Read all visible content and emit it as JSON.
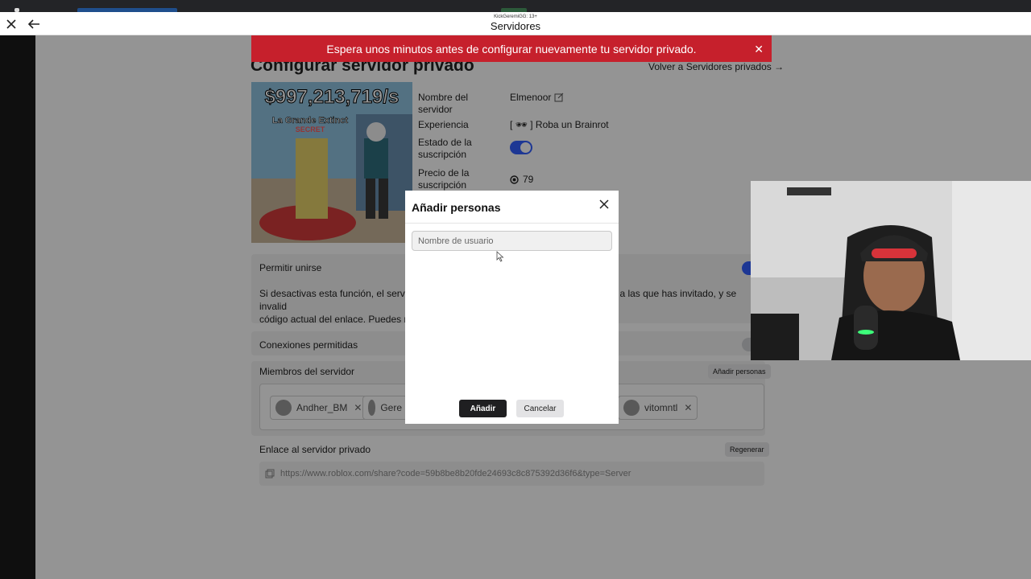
{
  "window": {
    "small_title": "KickGeremiGG: 13+",
    "title": "Servidores"
  },
  "page": {
    "heading": "Configurar servidor privado",
    "back_link": "Volver a Servidores privados →",
    "thumbnail": {
      "price_text": "$997,213,719/s",
      "subtitle": "La Grande Extinct",
      "tag": "SECRET"
    },
    "fields": {
      "server_name_label": "Nombre del servidor",
      "server_name_value": "Elmenoor",
      "experience_label": "Experiencia",
      "experience_value": "[ 🕶 ] Roba un Brainrot",
      "subscription_state_label": "Estado de la suscripción",
      "subscription_price_label": "Precio de la suscripción",
      "subscription_price_value": "79"
    },
    "allow_join_label": "Permitir unirse",
    "allow_join_desc_left": "Si desactivas esta función, el servidor",
    "allow_join_desc_right": "a las que has invitado, y se invalid",
    "allow_join_desc_line2": "código actual del enlace. Puedes reac",
    "connections_label": "Conexiones permitidas",
    "members_label": "Miembros del servidor",
    "add_people_button": "Añadir personas",
    "members": [
      "Andher_BM",
      "Gere",
      "vitomntl"
    ],
    "link_label": "Enlace al servidor privado",
    "regenerate_button": "Regenerar",
    "link_value": "https://www.roblox.com/share?code=59b8be8b20fde24693c8c875392d36f6&type=Server"
  },
  "banner": {
    "message": "Espera unos minutos antes de configurar nuevamente tu servidor privado."
  },
  "dialog": {
    "title": "Añadir personas",
    "input_placeholder": "Nombre de usuario",
    "add_button": "Añadir",
    "cancel_button": "Cancelar"
  },
  "colors": {
    "accent": "#335fff",
    "banner": "#c6202c",
    "primary_button": "#1f1f21"
  },
  "icons": {
    "close": "close-icon",
    "back": "arrow-left-icon",
    "edit": "edit-icon",
    "copy": "copy-icon",
    "robux": "robux-icon"
  }
}
